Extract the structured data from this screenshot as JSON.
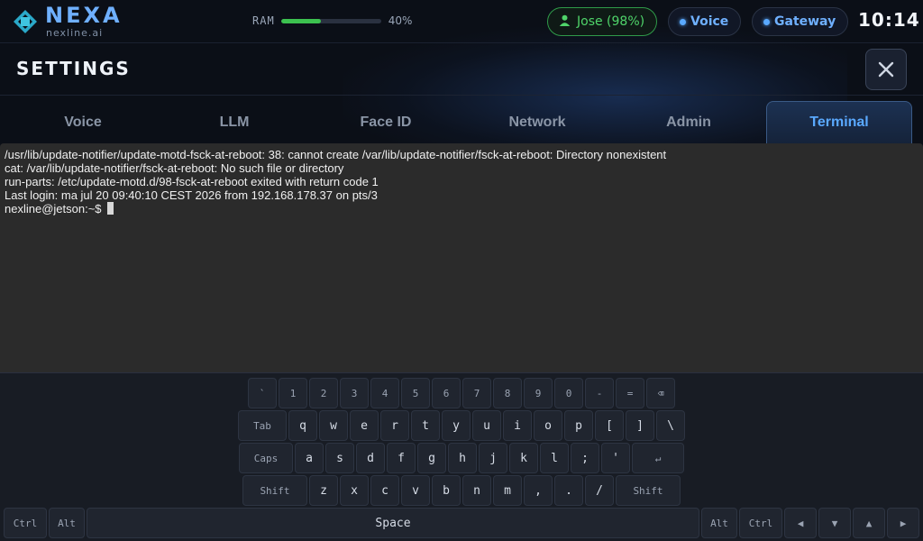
{
  "brand": {
    "name": "NEXA",
    "domain": "nexline.ai"
  },
  "ram": {
    "label": "RAM",
    "percent": 40,
    "text": "40%"
  },
  "status": {
    "user": {
      "text": "Jose (98%)",
      "color": "#4fd46a"
    },
    "voice": {
      "text": "Voice"
    },
    "gateway": {
      "text": "Gateway"
    },
    "clock": "10:14"
  },
  "header": {
    "title": "SETTINGS"
  },
  "tabs": [
    {
      "label": "Voice"
    },
    {
      "label": "LLM"
    },
    {
      "label": "Face ID"
    },
    {
      "label": "Network"
    },
    {
      "label": "Admin"
    },
    {
      "label": "Terminal",
      "active": true
    }
  ],
  "terminal": {
    "lines": [
      "/usr/lib/update-notifier/update-motd-fsck-at-reboot: 38: cannot create /var/lib/update-notifier/fsck-at-reboot: Directory nonexistent",
      "cat: /var/lib/update-notifier/fsck-at-reboot: No such file or directory",
      "run-parts: /etc/update-motd.d/98-fsck-at-reboot exited with return code 1",
      "Last login: ma jul 20 09:40:10 CEST 2026 from 192.168.178.37 on pts/3"
    ],
    "prompt": "nexline@jetson:~$"
  },
  "keyboard": {
    "row1": [
      "`",
      "1",
      "2",
      "3",
      "4",
      "5",
      "6",
      "7",
      "8",
      "9",
      "0",
      "-",
      "=",
      "⌫"
    ],
    "row2": [
      "Tab",
      "q",
      "w",
      "e",
      "r",
      "t",
      "y",
      "u",
      "i",
      "o",
      "p",
      "[",
      "]",
      "\\"
    ],
    "row3": [
      "Caps",
      "a",
      "s",
      "d",
      "f",
      "g",
      "h",
      "j",
      "k",
      "l",
      ";",
      "'",
      "↵"
    ],
    "row4": [
      "Shift",
      "z",
      "x",
      "c",
      "v",
      "b",
      "n",
      "m",
      ",",
      ".",
      "/",
      "Shift"
    ],
    "row5": [
      "Ctrl",
      "Alt",
      "Space",
      "Alt",
      "Ctrl",
      "◀",
      "▼",
      "▲",
      "▶"
    ]
  },
  "colors": {
    "accent": "#5aa9ff",
    "ok": "#3cc14f",
    "terminal_bg": "#2b2b2b"
  }
}
